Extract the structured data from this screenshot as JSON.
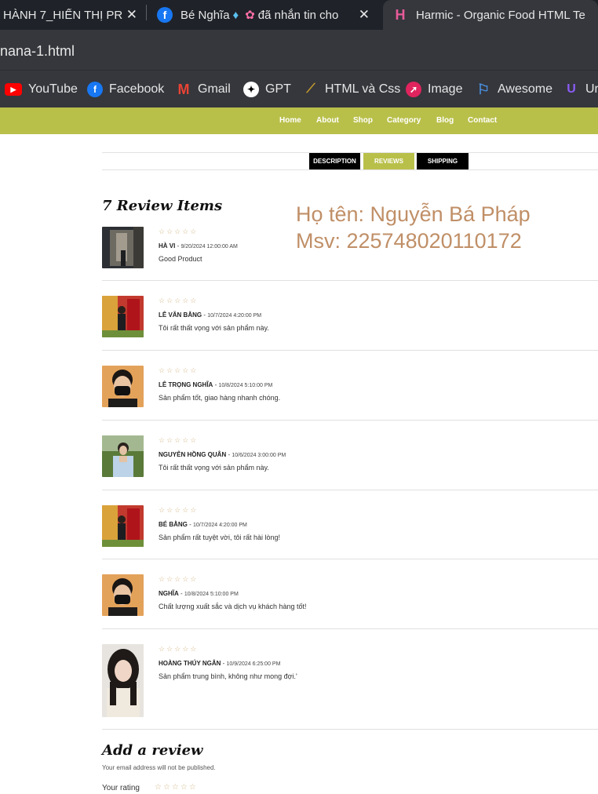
{
  "browser": {
    "tabs": [
      {
        "label": "HÀNH 7_HIỂN THỊ PR",
        "close": "✕"
      },
      {
        "label_prefix": "Bé Nghĩa",
        "label_suffix": "đã nhắn tin cho",
        "close": "✕"
      },
      {
        "label": "Harmic - Organic Food HTML Te"
      }
    ],
    "url": "nana-1.html",
    "bookmarks": [
      {
        "label": "YouTube",
        "icon": "youtube-icon"
      },
      {
        "label": "Facebook",
        "icon": "facebook-icon"
      },
      {
        "label": "Gmail",
        "icon": "gmail-icon"
      },
      {
        "label": "GPT",
        "icon": "chatgpt-icon"
      },
      {
        "label": "HTML và Css",
        "icon": "html-icon"
      },
      {
        "label": "Image",
        "icon": "image-icon"
      },
      {
        "label": "Awesome",
        "icon": "flag-icon"
      },
      {
        "label": "Ur",
        "icon": "ui-icon"
      }
    ]
  },
  "site": {
    "nav": [
      "Home",
      "About",
      "Shop",
      "Category",
      "Blog",
      "Contact"
    ],
    "product_tabs": [
      "DESCRIPTION",
      "REVIEWS",
      "SHIPPING"
    ],
    "review_heading": "7 Review Items",
    "student_name": "Họ tên: Nguyễn Bá Pháp",
    "student_id": "Msv: 225748020110172",
    "stars": "☆☆☆☆☆",
    "reviews": [
      {
        "name": "HÀ VI",
        "date": "9/20/2024 12:00:00 AM",
        "comment": "Good Product"
      },
      {
        "name": "LÊ VĂN BẰNG",
        "date": "10/7/2024 4:20:00 PM",
        "comment": "Tôi rất thất vọng với sản phẩm này."
      },
      {
        "name": "LÊ TRỌNG NGHĨA",
        "date": "10/8/2024 5:10:00 PM",
        "comment": "Sản phẩm tốt, giao hàng nhanh chóng."
      },
      {
        "name": "NGUYỄN HỒNG QUÂN",
        "date": "10/6/2024 3:00:00 PM",
        "comment": "Tôi rất thất vọng với sản phẩm này."
      },
      {
        "name": "BÉ BẰNG",
        "date": "10/7/2024 4:20:00 PM",
        "comment": "Sản phẩm rất tuyệt vời, tôi rất hài lòng!"
      },
      {
        "name": "NGHĨA",
        "date": "10/8/2024 5:10:00 PM",
        "comment": "Chất lượng xuất sắc và dịch vụ khách hàng tốt!"
      },
      {
        "name": "HOÀNG THÚY NGÂN",
        "date": "10/9/2024 6:25:00 PM",
        "comment": "Sản phẩm trung bình, không như mong đợi.'"
      }
    ],
    "add_review_title": "Add a review",
    "add_review_note": "Your email address will not be published.",
    "rating_label": "Your rating",
    "accent_color": "#b9c04a",
    "student_text_color": "#c08f67"
  }
}
